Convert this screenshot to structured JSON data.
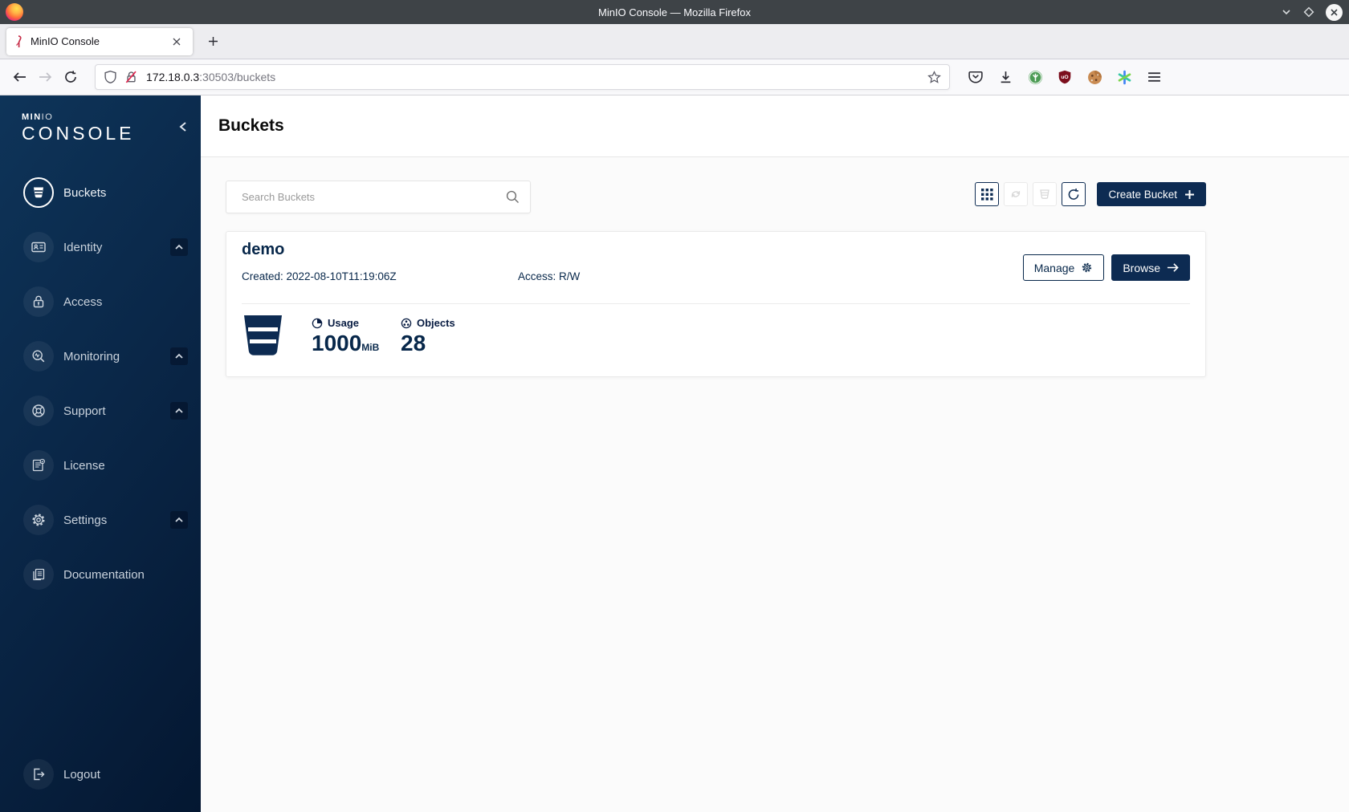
{
  "browser": {
    "titlebar": {
      "title": "MinIO Console — Mozilla Firefox"
    },
    "tab": {
      "title": "MinIO Console"
    },
    "urlbar": {
      "host": "172.18.0.3",
      "path": ":30503/buckets"
    }
  },
  "sidebar": {
    "logo": {
      "brand_bold": "MIN",
      "brand_light": "IO",
      "product": "CONSOLE"
    },
    "items": [
      {
        "label": "Buckets"
      },
      {
        "label": "Identity"
      },
      {
        "label": "Access"
      },
      {
        "label": "Monitoring"
      },
      {
        "label": "Support"
      },
      {
        "label": "License"
      },
      {
        "label": "Settings"
      },
      {
        "label": "Documentation"
      }
    ],
    "logout_label": "Logout"
  },
  "main": {
    "page_title": "Buckets",
    "search_placeholder": "Search Buckets",
    "create_button_label": "Create Bucket",
    "bucket": {
      "name": "demo",
      "created": "Created: 2022-08-10T11:19:06Z",
      "access": "Access: R/W",
      "manage_label": "Manage",
      "browse_label": "Browse",
      "usage_label": "Usage",
      "usage_value": "1000",
      "usage_unit": "MiB",
      "objects_label": "Objects",
      "objects_value": "28"
    }
  },
  "colors": {
    "navy": "#0D2B52",
    "navy_text": "#07274A",
    "brand_red": "#C72E49"
  }
}
